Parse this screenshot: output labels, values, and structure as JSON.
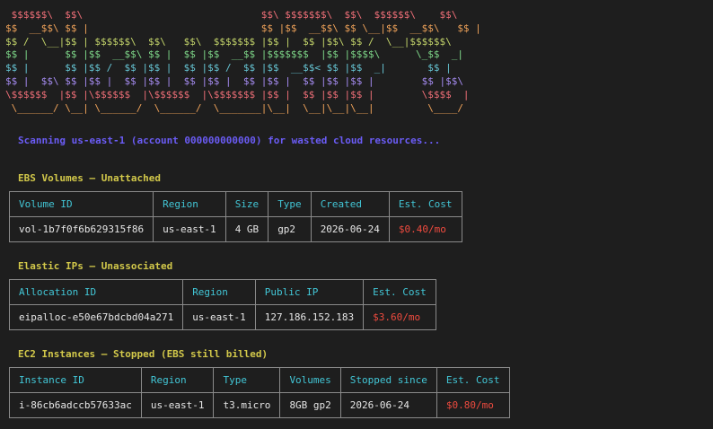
{
  "banner": {
    "lines": [
      {
        "text": " $$$$$$\\  $$\\                              $$\\ $$$$$$$\\  $$\\  $$$$$$\\    $$\\",
        "color": "#f06f78"
      },
      {
        "text": "$$  __$$\\ $$ |                             $$ |$$  __$$\\ $$ \\__|$$  __$$\\   $$ |",
        "color": "#f0a35a"
      },
      {
        "text": "$$ /  \\__|$$ | $$$$$$\\  $$\\   $$\\  $$$$$$$ |$$ |  $$ |$$\\ $$ /  \\__|$$$$$$\\",
        "color": "#c5d66b"
      },
      {
        "text": "$$ |      $$ |$$  __$$\\ $$ |  $$ |$$  __$$ |$$$$$$$  |$$ |$$$$\\      \\_$$  _|",
        "color": "#7fd98a"
      },
      {
        "text": "$$ |      $$ |$$ /  $$ |$$ |  $$ |$$ /  $$ |$$  __$$< $$ |$$  _|       $$ |",
        "color": "#67c7d6"
      },
      {
        "text": "$$ |  $$\\ $$ |$$ |  $$ |$$ |  $$ |$$ |  $$ |$$ |  $$ |$$ |$$ |        $$ |$$\\",
        "color": "#a68cf2"
      },
      {
        "text": "\\$$$$$$  |$$ |\\$$$$$$  |\\$$$$$$  |\\$$$$$$$ |$$ |  $$ |$$ |$$ |        \\$$$$  |",
        "color": "#f06f78"
      },
      {
        "text": " \\______/ \\__| \\______/  \\______/  \\_______|\\__|  \\__|\\__|\\__|         \\____/",
        "color": "#f0a35a"
      }
    ]
  },
  "scan_message": "Scanning us-east-1 (account 000000000000) for wasted cloud resources...",
  "sections": {
    "ebs": {
      "title": "EBS Volumes — Unattached",
      "headers": [
        "Volume ID",
        "Region",
        "Size",
        "Type",
        "Created",
        "Est. Cost"
      ],
      "rows": [
        [
          "vol-1b7f0f6b629315f86",
          "us-east-1",
          "4 GB",
          "gp2",
          "2026-06-24",
          "$0.40/mo"
        ]
      ]
    },
    "eip": {
      "title": "Elastic IPs — Unassociated",
      "headers": [
        "Allocation ID",
        "Region",
        "Public IP",
        "Est. Cost"
      ],
      "rows": [
        [
          "eipalloc-e50e67bdcbd04a271",
          "us-east-1",
          "127.186.152.183",
          "$3.60/mo"
        ]
      ]
    },
    "ec2": {
      "title": "EC2 Instances — Stopped (EBS still billed)",
      "headers": [
        "Instance ID",
        "Region",
        "Type",
        "Volumes",
        "Stopped since",
        "Est. Cost"
      ],
      "rows": [
        [
          "i-86cb6adccb57633ac",
          "us-east-1",
          "t3.micro",
          "8GB gp2",
          "2026-06-24",
          "$0.80/mo"
        ]
      ]
    }
  },
  "colors": {
    "background": "#1e1e1e",
    "scan_text": "#6b5cf6",
    "section_title": "#d2c84a",
    "table_header": "#42c6d6",
    "cost": "#ef4b3f",
    "table_border": "#8a8a8a"
  }
}
